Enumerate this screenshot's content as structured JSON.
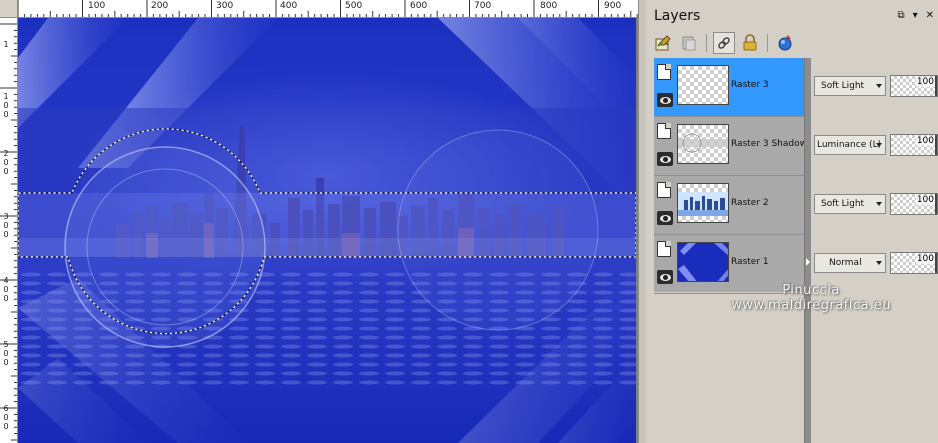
{
  "ruler_top": {
    "labels": [
      "100",
      "200",
      "300",
      "400",
      "500",
      "600",
      "700",
      "800",
      "900"
    ]
  },
  "ruler_left": {
    "labels": [
      "1",
      "100",
      "200",
      "300",
      "400",
      "500",
      "600"
    ]
  },
  "canvas": {
    "colors": {
      "background": "#1428b4",
      "sky": "#2c3cc4",
      "stripe": "#a8b4ff",
      "selection": "#ffffff"
    }
  },
  "layers_panel": {
    "title": "Layers",
    "title_controls": [
      "pin-icon",
      "menu-arrow-icon",
      "close-icon"
    ],
    "toolbar_icons": [
      "new-raster-layer-icon",
      "new-mask-layer-icon",
      "link-layers-icon",
      "lock-transparency-icon",
      "view-all-layers-icon"
    ],
    "layers": [
      {
        "name": "Raster 3",
        "blend_mode": "Soft Light",
        "opacity": "100",
        "selected": true
      },
      {
        "name": "Raster 3 Shadow",
        "blend_mode": "Luminance (L)",
        "opacity": "100",
        "selected": false
      },
      {
        "name": "Raster 2",
        "blend_mode": "Soft Light",
        "opacity": "100",
        "selected": false
      },
      {
        "name": "Raster 1",
        "blend_mode": "Normal",
        "opacity": "100",
        "selected": false
      }
    ],
    "selected_color": "#3399ff"
  },
  "watermark": {
    "line1": "Pinuccia",
    "line2": "www.maldiregrafica.eu"
  }
}
